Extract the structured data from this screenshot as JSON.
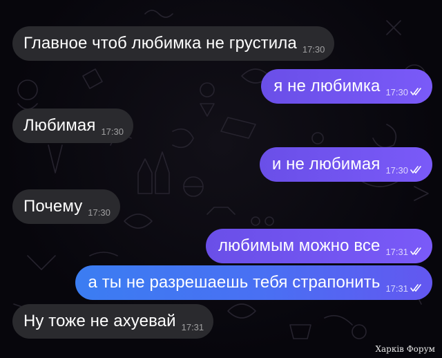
{
  "messages": [
    {
      "direction": "in",
      "text": "Главное чтоб любимка не грустила",
      "time": "17:30"
    },
    {
      "direction": "out",
      "text": "я не любимка",
      "time": "17:30",
      "status": "read-double-check"
    },
    {
      "direction": "in",
      "text": "Любимая",
      "time": "17:30"
    },
    {
      "direction": "out",
      "text": "и не любимая",
      "time": "17:30",
      "status": "read-double-check"
    },
    {
      "direction": "in",
      "text": "Почему",
      "time": "17:30"
    },
    {
      "direction": "out",
      "text": "любимым можно все",
      "time": "17:31",
      "status": "read-double-check"
    },
    {
      "direction": "out",
      "text": "а ты не разрешаешь тебя страпонить",
      "time": "17:31",
      "status": "read-double-check"
    },
    {
      "direction": "in",
      "text": "Ну тоже не ахуевай",
      "time": "17:31"
    }
  ],
  "watermark": "Харків Форум",
  "colors": {
    "background": "#07060c",
    "incoming_bubble": "#2a2a2e",
    "outgoing_bubble": "#7a5af8",
    "outgoing_bubble_blue": "#3b7df2",
    "text": "#ffffff"
  }
}
